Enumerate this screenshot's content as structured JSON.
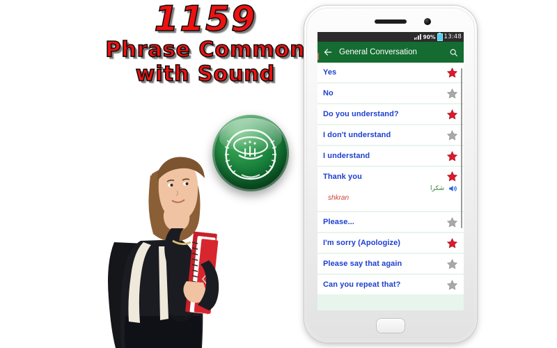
{
  "promo": {
    "number": "1159",
    "line2": "Phrase Common",
    "line3": "with Sound",
    "title_color": "#ee1111"
  },
  "flag": {
    "name": "arab-league-flag-badge",
    "base_color": "#17803a",
    "emblem_color": "#ffffff"
  },
  "photo": {
    "name": "student-girl-with-books-photo",
    "description": "Student girl holding red and white books with black backpack"
  },
  "phone": {
    "frame_color": "#f2f2f2",
    "status_bar": {
      "signal_icon": "signal-bars-icon",
      "battery_percent": "90%",
      "battery_icon": "battery-icon",
      "time": "13:48"
    },
    "app_bar": {
      "back_icon": "back-arrow-icon",
      "title": "General Conversation",
      "search_icon": "search-icon",
      "background_color": "#146c31"
    },
    "home_button_label": "home-button"
  },
  "list": {
    "background_color": "#e8f5ec",
    "text_color": "#1b3fd0",
    "star_red": "#e4162b",
    "star_gray": "#a9a9a9",
    "rows": [
      {
        "label": "Yes",
        "starred": true,
        "expanded": false
      },
      {
        "label": "No",
        "starred": false,
        "expanded": false
      },
      {
        "label": "Do you understand?",
        "starred": true,
        "expanded": false
      },
      {
        "label": "I don't understand",
        "starred": false,
        "expanded": false
      },
      {
        "label": "I understand",
        "starred": true,
        "expanded": false
      },
      {
        "label": "Thank you",
        "starred": true,
        "expanded": true,
        "arabic": "شكرا",
        "transliteration": "shkran",
        "speaker_icon": "speaker-icon"
      },
      {
        "label": "Please...",
        "starred": false,
        "expanded": false
      },
      {
        "label": "I'm sorry (Apologize)",
        "starred": true,
        "expanded": false
      },
      {
        "label": "Please say that again",
        "starred": false,
        "expanded": false
      },
      {
        "label": "Can you repeat that?",
        "starred": false,
        "expanded": false
      }
    ]
  }
}
